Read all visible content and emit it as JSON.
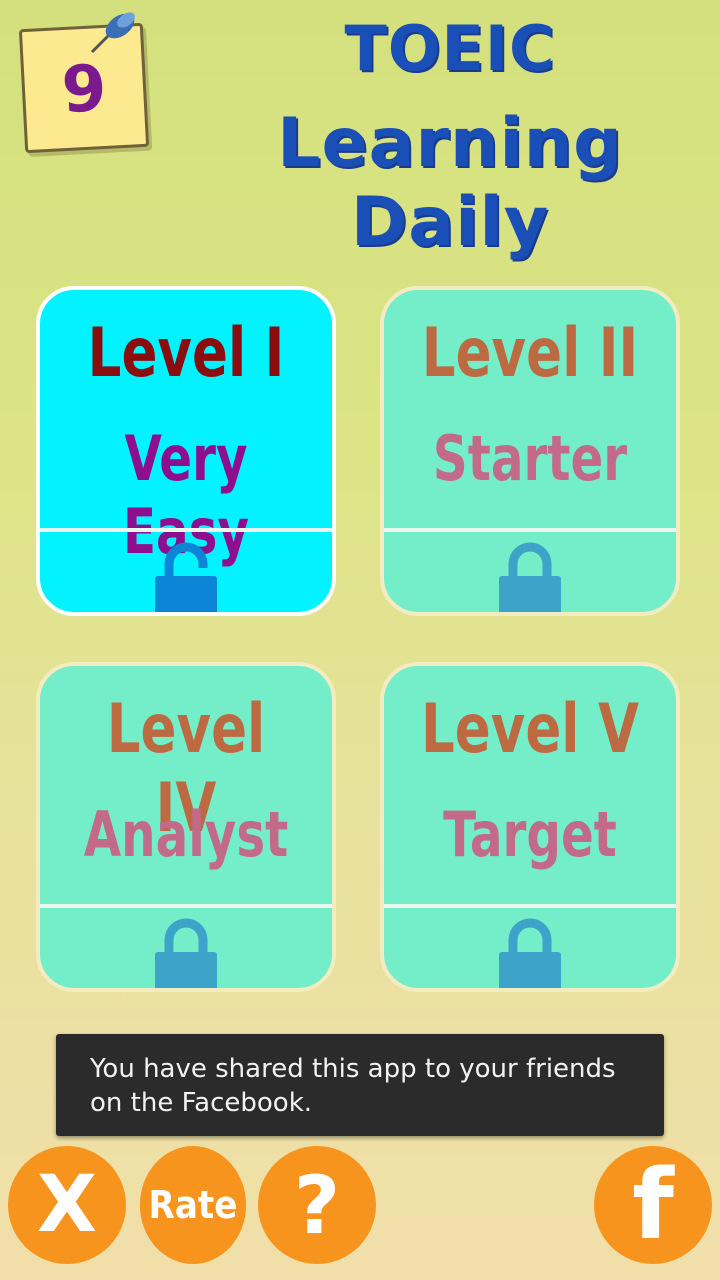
{
  "header": {
    "day_number": "9",
    "title_line1": "TOEIC",
    "title_line2": "Learning Daily"
  },
  "levels": [
    {
      "level": "Level I",
      "name": "Very Easy",
      "locked": false
    },
    {
      "level": "Level II",
      "name": "Starter",
      "locked": true
    },
    {
      "level": "Level IV",
      "name": "Analyst",
      "locked": true
    },
    {
      "level": "Level V",
      "name": "Target",
      "locked": true
    }
  ],
  "toast": {
    "line1": "You have shared this app to your friends",
    "line2": "on the Facebook."
  },
  "bottom_bar": {
    "exit_label": "X",
    "rate_label": "Rate",
    "help_label": "?",
    "facebook_label": "f"
  },
  "colors": {
    "accent_orange": "#f7941d",
    "title_blue": "#1a4fb8",
    "card_active": "#00f3ff",
    "card_locked": "#74edc9",
    "lock_open": "#0b86d6",
    "lock_closed": "#3da3c8"
  },
  "icons": {
    "pin": "pushpin-icon",
    "lock_open": "unlocked-padlock-icon",
    "lock_closed": "locked-padlock-icon"
  }
}
